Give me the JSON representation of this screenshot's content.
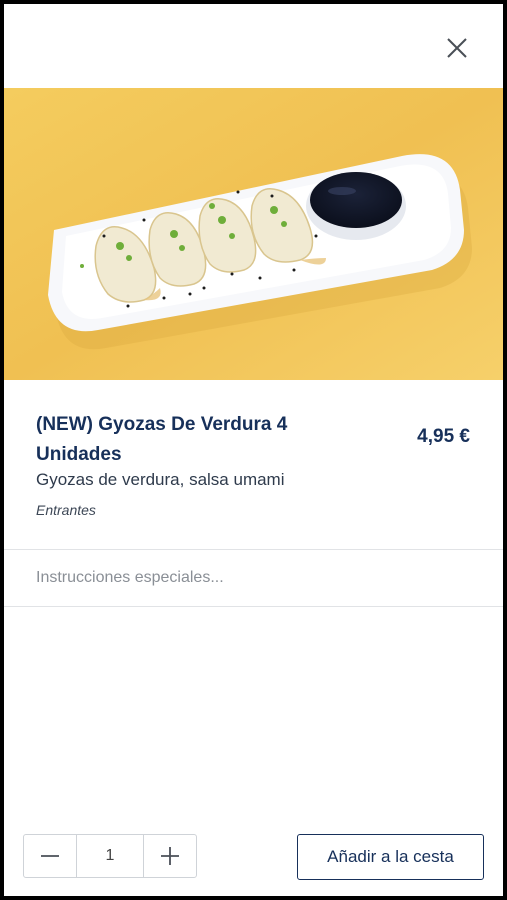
{
  "modal": {
    "close_icon": "close-icon"
  },
  "product": {
    "image_icon": "gyoza-plate-image",
    "title": "(NEW) Gyozas De Verdura 4 Unidades",
    "price": "4,95 €",
    "description": "Gyozas de verdura, salsa umami",
    "category": "Entrantes"
  },
  "instructions": {
    "placeholder": "Instrucciones especiales..."
  },
  "footer": {
    "quantity": "1",
    "decrement_icon": "minus-icon",
    "increment_icon": "plus-icon",
    "add_label": "Añadir a la cesta"
  },
  "colors": {
    "brand_navy": "#17305a",
    "hero_background": "#f2c95a"
  }
}
